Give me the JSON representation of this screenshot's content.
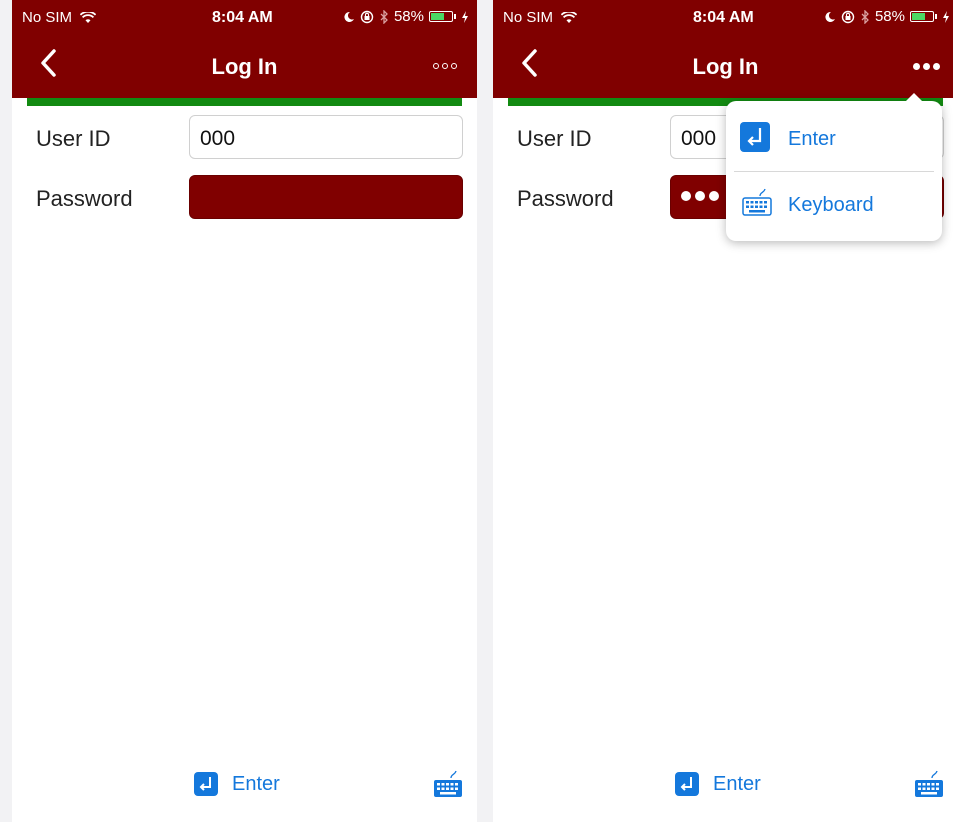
{
  "status_bar": {
    "carrier": "No SIM",
    "time": "8:04 AM",
    "battery": "58%"
  },
  "nav": {
    "title": "Log In"
  },
  "form": {
    "user_id_label": "User ID",
    "user_id_value": "000",
    "password_label": "Password"
  },
  "toolbar": {
    "enter_label": "Enter"
  },
  "popover_menu": {
    "items": [
      {
        "label": "Enter",
        "icon": "enter-icon"
      },
      {
        "label": "Keyboard",
        "icon": "keyboard-icon"
      }
    ]
  },
  "colors": {
    "brand": "#800000",
    "accent": "#1478dc",
    "progress": "#128a11"
  }
}
